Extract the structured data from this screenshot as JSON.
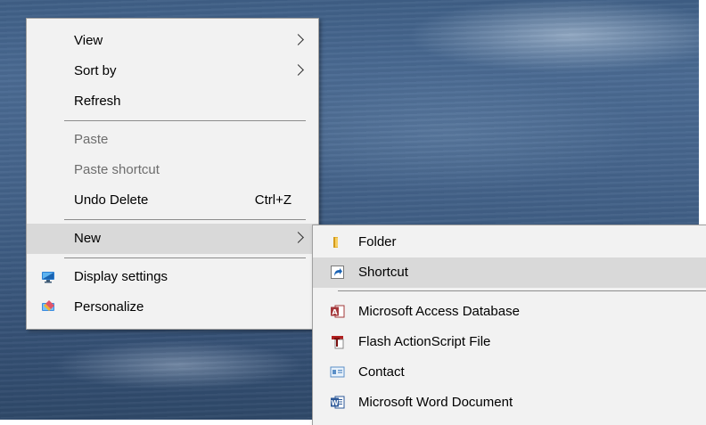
{
  "context_menu": {
    "items": [
      {
        "label": "View"
      },
      {
        "label": "Sort by"
      },
      {
        "label": "Refresh"
      },
      {
        "label": "Paste"
      },
      {
        "label": "Paste shortcut"
      },
      {
        "label": "Undo Delete",
        "shortcut": "Ctrl+Z"
      },
      {
        "label": "New"
      },
      {
        "label": "Display settings",
        "icon": "display-settings-icon"
      },
      {
        "label": "Personalize",
        "icon": "personalize-icon"
      }
    ]
  },
  "new_submenu": {
    "items": [
      {
        "label": "Folder",
        "icon": "folder-icon"
      },
      {
        "label": "Shortcut",
        "icon": "shortcut-icon"
      },
      {
        "label": "Microsoft Access Database",
        "icon": "access-database-icon"
      },
      {
        "label": "Flash ActionScript File",
        "icon": "flash-actionscript-icon"
      },
      {
        "label": "Contact",
        "icon": "contact-icon"
      },
      {
        "label": "Microsoft Word Document",
        "icon": "word-document-icon"
      }
    ]
  },
  "colors": {
    "menu_background": "#f2f2f2",
    "highlight": "#d9d9d9",
    "disabled_text": "#6d6d6d",
    "separator": "#8c8c8c"
  }
}
